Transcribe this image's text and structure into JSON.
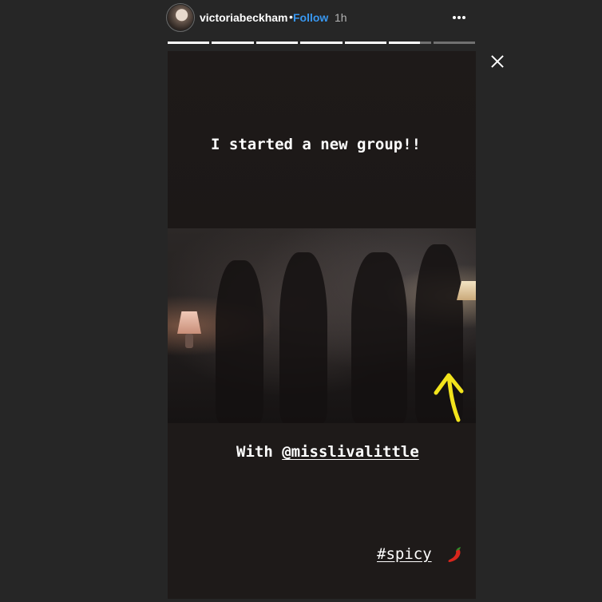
{
  "header": {
    "username": "victoriabeckham",
    "separator": "•",
    "follow_label": "Follow",
    "timestamp": "1h"
  },
  "progress": {
    "segment_count": 7,
    "fills": [
      1,
      1,
      1,
      1,
      1,
      0.75,
      0
    ]
  },
  "story": {
    "caption_top": "I started a new group!!",
    "caption_with_prefix": "With ",
    "mention": "@misslivalittle",
    "hashtag": "#spicy",
    "arrow_color": "#f2e41c",
    "pepper_color": "#d8261c"
  },
  "icons": {
    "more": "more-options-icon",
    "close": "close-icon",
    "arrow": "arrow-up-icon",
    "pepper": "hot-pepper-icon"
  }
}
